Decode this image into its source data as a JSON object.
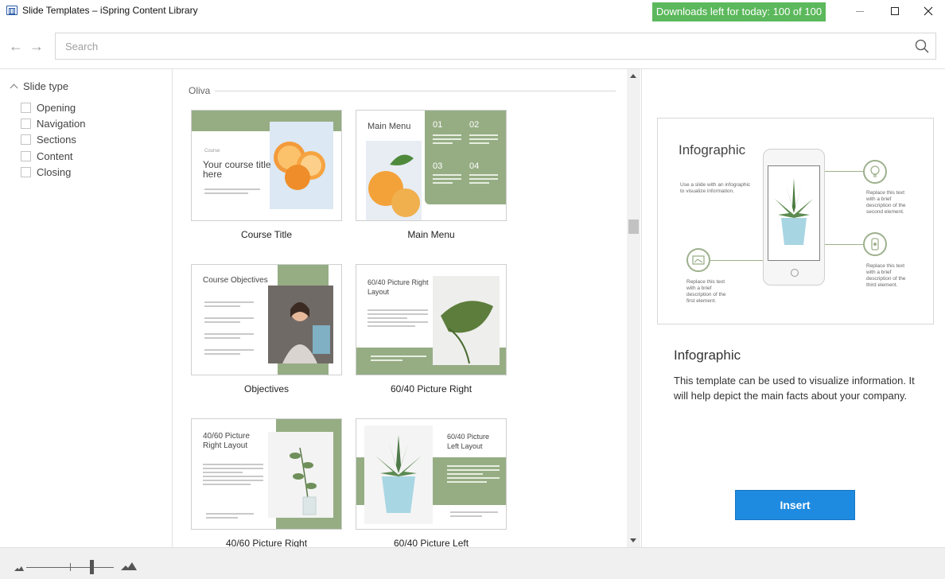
{
  "window": {
    "title": "Slide Templates – iSpring Content Library",
    "downloads_badge": "Downloads left for today: 100 of 100"
  },
  "search": {
    "placeholder": "Search",
    "value": ""
  },
  "sidebar": {
    "heading": "Slide type",
    "items": [
      {
        "label": "Opening",
        "checked": false
      },
      {
        "label": "Navigation",
        "checked": false
      },
      {
        "label": "Sections",
        "checked": false
      },
      {
        "label": "Content",
        "checked": false
      },
      {
        "label": "Closing",
        "checked": false
      }
    ]
  },
  "gallery": {
    "group_label": "Oliva",
    "cards": [
      {
        "caption": "Course Title",
        "thumb_title": "Your course title here"
      },
      {
        "caption": "Main Menu",
        "thumb_title": "Main Menu",
        "numbers": [
          "01",
          "02",
          "03",
          "04"
        ]
      },
      {
        "caption": "Objectives",
        "thumb_title": "Course Objectives"
      },
      {
        "caption": "60/40 Picture Right",
        "thumb_title": "60/40 Picture Right Layout"
      },
      {
        "caption": "40/60 Picture Right",
        "thumb_title": "40/60 Picture Right Layout"
      },
      {
        "caption": "60/40 Picture Left",
        "thumb_title": "60/40 Picture Left Layout"
      }
    ]
  },
  "preview": {
    "slide_title": "Infographic",
    "slide_intro": "Use a slide with an infographic to visualize information.",
    "callout_1": "Replace this text with a brief description of the first element.",
    "callout_2": "Replace this text with a brief description of the second element.",
    "callout_3": "Replace this text with a brief description of the third element.",
    "title": "Infographic",
    "description": "This template can be used to visualize information. It will help depict the main facts about your company.",
    "insert_label": "Insert"
  },
  "colors": {
    "accent_green": "#96ad84",
    "badge_green": "#5cb85c",
    "insert_blue": "#1f8be0"
  }
}
